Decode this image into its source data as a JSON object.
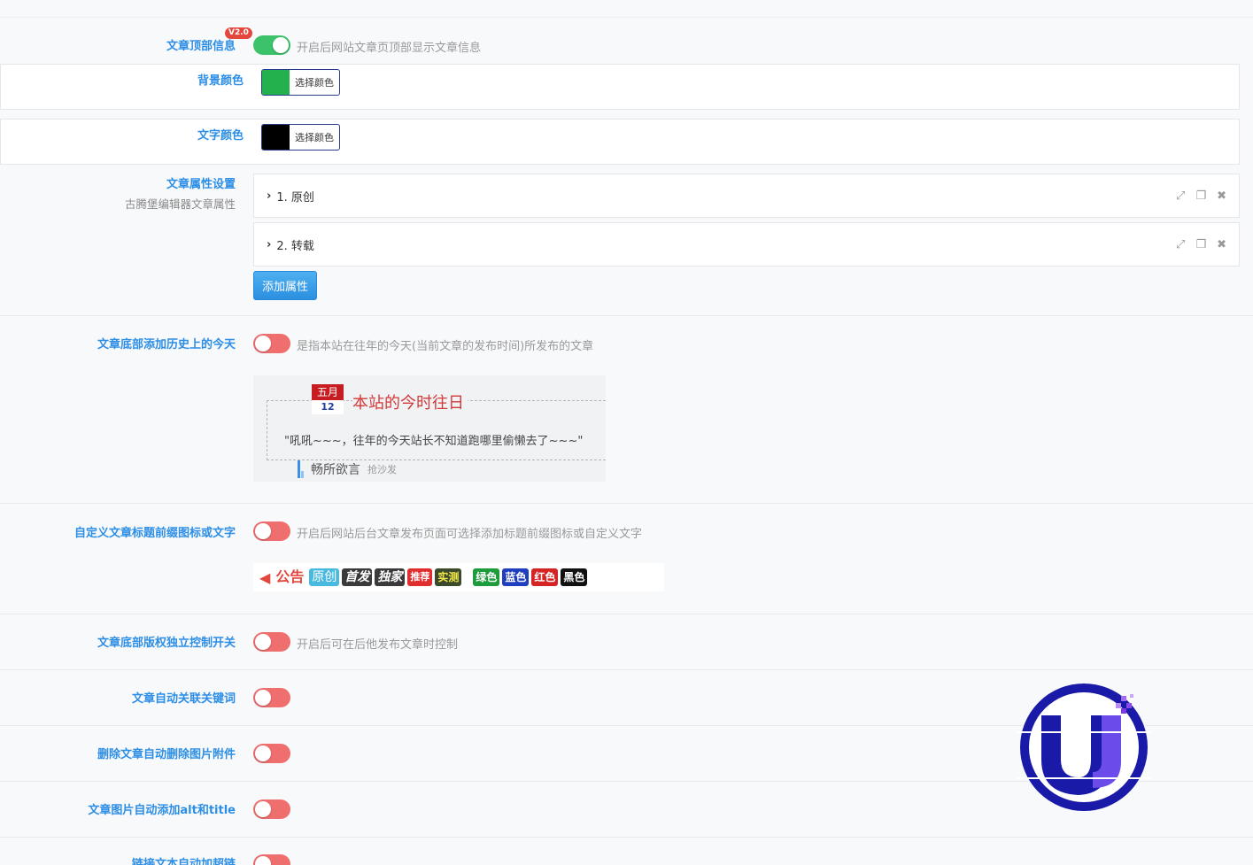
{
  "settings": {
    "top_info": {
      "label": "文章顶部信息",
      "badge": "V2.0",
      "on": true,
      "desc": "开启后网站文章页顶部显示文章信息"
    },
    "bg_color": {
      "label": "背景颜色",
      "button": "选择颜色",
      "color": "#22b14c"
    },
    "text_color": {
      "label": "文字颜色",
      "button": "选择颜色",
      "color": "#000000"
    },
    "attrs": {
      "label": "文章属性设置",
      "sublabel": "古腾堡编辑器文章属性",
      "items": [
        {
          "title": "1. 原创"
        },
        {
          "title": "2. 转载"
        }
      ],
      "add_button": "添加属性"
    },
    "history": {
      "label": "文章底部添加历史上的今天",
      "on": false,
      "desc": "是指本站在往年的今天(当前文章的发布时间)所发布的文章",
      "preview": {
        "month": "五月",
        "day": "12",
        "title": "本站的今时往日",
        "quote": "\"吼吼~~~，往年的今天站长不知道跑哪里偷懒去了~~~\"",
        "author": "畅所欲言",
        "sofa": "抢沙发"
      }
    },
    "prefix": {
      "label": "自定义文章标题前缀图标或文字",
      "on": false,
      "desc": "开启后网站后台文章发布页面可选择添加标题前缀图标或自定义文字",
      "tags": [
        "公告",
        "原创",
        "首发",
        "独家",
        "推荐",
        "实测",
        "绿色",
        "蓝色",
        "红色",
        "黑色"
      ]
    },
    "copyright": {
      "label": "文章底部版权独立控制开关",
      "on": false,
      "desc": "开启后可在后他发布文章时控制"
    },
    "auto_keywords": {
      "label": "文章自动关联关键词",
      "on": false
    },
    "delete_images": {
      "label": "删除文章自动删除图片附件",
      "on": false
    },
    "alt_title": {
      "label": "文章图片自动添加alt和title",
      "on": false
    },
    "auto_link": {
      "label": "链接文本自动加超链",
      "on": false
    }
  },
  "colors": {
    "accent": "#2d8ee6",
    "toggle_on": "#3cc26a",
    "toggle_off": "#ef6f6f"
  },
  "icons": {
    "expand": "expand-icon",
    "copy": "copy-icon",
    "close": "close-icon",
    "chevron": "chevron-right-icon"
  }
}
